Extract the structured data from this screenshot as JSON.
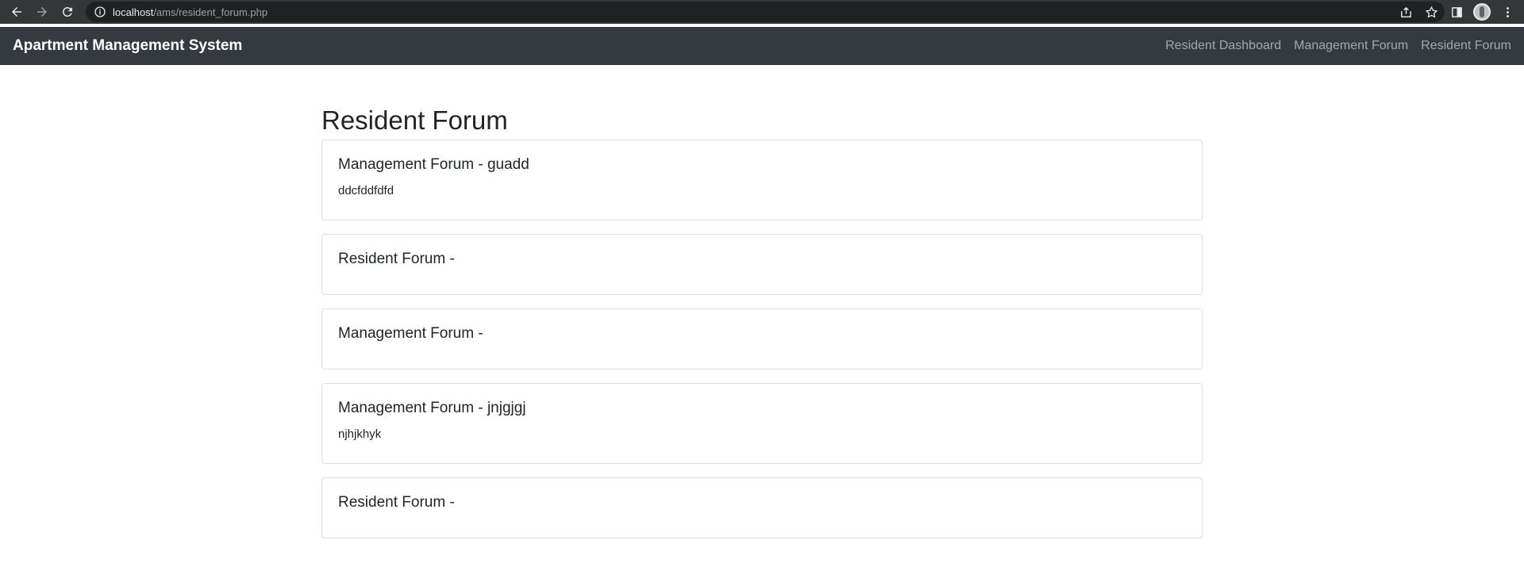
{
  "browser": {
    "url_host": "localhost",
    "url_path": "/ams/resident_forum.php"
  },
  "navbar": {
    "brand": "Apartment Management System",
    "links": [
      {
        "label": "Resident Dashboard"
      },
      {
        "label": "Management Forum"
      },
      {
        "label": "Resident Forum"
      }
    ]
  },
  "page": {
    "title": "Resident Forum"
  },
  "posts": [
    {
      "title": "Management Forum - guadd",
      "body": "ddcfddfdfd"
    },
    {
      "title": "Resident Forum -",
      "body": ""
    },
    {
      "title": "Management Forum -",
      "body": ""
    },
    {
      "title": "Management Forum - jnjgjgj",
      "body": "njhjkhyk"
    },
    {
      "title": "Resident Forum -",
      "body": ""
    }
  ]
}
